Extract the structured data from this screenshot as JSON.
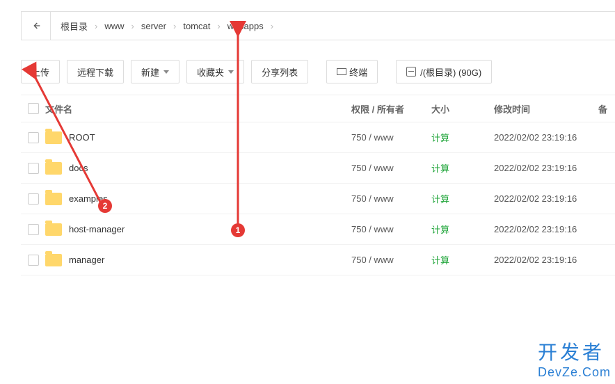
{
  "breadcrumb": [
    "根目录",
    "www",
    "server",
    "tomcat",
    "webapps"
  ],
  "toolbar": {
    "upload": "上传",
    "remote": "远程下载",
    "new": "新建",
    "fav": "收藏夹",
    "share": "分享列表",
    "terminal": "终端",
    "disk": "/(根目录) (90G)"
  },
  "columns": {
    "name": "文件名",
    "perm": "权限 / 所有者",
    "size": "大小",
    "date": "修改时间",
    "op": "备"
  },
  "rows": [
    {
      "name": "ROOT",
      "perm": "750 / www",
      "size": "计算",
      "date": "2022/02/02 23:19:16"
    },
    {
      "name": "docs",
      "perm": "750 / www",
      "size": "计算",
      "date": "2022/02/02 23:19:16"
    },
    {
      "name": "examples",
      "perm": "750 / www",
      "size": "计算",
      "date": "2022/02/02 23:19:16"
    },
    {
      "name": "host-manager",
      "perm": "750 / www",
      "size": "计算",
      "date": "2022/02/02 23:19:16"
    },
    {
      "name": "manager",
      "perm": "750 / www",
      "size": "计算",
      "date": "2022/02/02 23:19:16"
    }
  ],
  "notes": {
    "n1": "1",
    "n2": "2"
  },
  "watermark": {
    "l1": "开发者",
    "l2": "DevZe.Com"
  }
}
